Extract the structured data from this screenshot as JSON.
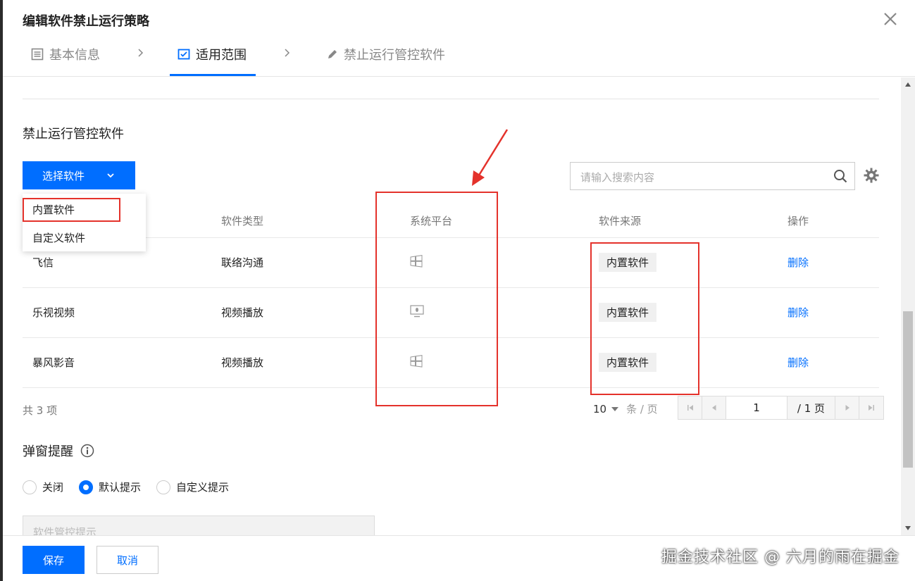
{
  "dialog": {
    "title": "编辑软件禁止运行策略"
  },
  "steps": [
    {
      "label": "基本信息",
      "icon": "list-icon"
    },
    {
      "label": "适用范围",
      "icon": "scope-icon"
    },
    {
      "label": "禁止运行管控软件",
      "icon": "pencil-icon"
    }
  ],
  "section": {
    "title": "禁止运行管控软件",
    "select_button": "选择软件",
    "dropdown": [
      "内置软件",
      "自定义软件"
    ],
    "search_placeholder": "请输入搜索内容"
  },
  "table": {
    "columns": [
      "",
      "软件类型",
      "系统平台",
      "软件来源",
      "操作"
    ],
    "rows": [
      {
        "name": "飞信",
        "type": "联络沟通",
        "platform": "windows-icon",
        "source": "内置软件",
        "action": "删除"
      },
      {
        "name": "乐视视频",
        "type": "视频播放",
        "platform": "mac-icon",
        "source": "内置软件",
        "action": "删除"
      },
      {
        "name": "暴风影音",
        "type": "视频播放",
        "platform": "windows-icon",
        "source": "内置软件",
        "action": "删除"
      }
    ]
  },
  "pagination": {
    "total": "共 3 项",
    "page_size": "10",
    "page_size_unit": "条 / 页",
    "current_page": "1",
    "total_pages": "/ 1 页"
  },
  "popup": {
    "title": "弹窗提醒",
    "options": [
      "关闭",
      "默认提示",
      "自定义提示"
    ],
    "selected": 1,
    "text_placeholder": "软件管控提示"
  },
  "footer": {
    "save": "保存",
    "cancel": "取消"
  },
  "watermark": "掘金技术社区 @ 六月的雨在掘金",
  "colors": {
    "primary": "#006eff",
    "annotation_red": "#e4322b"
  }
}
